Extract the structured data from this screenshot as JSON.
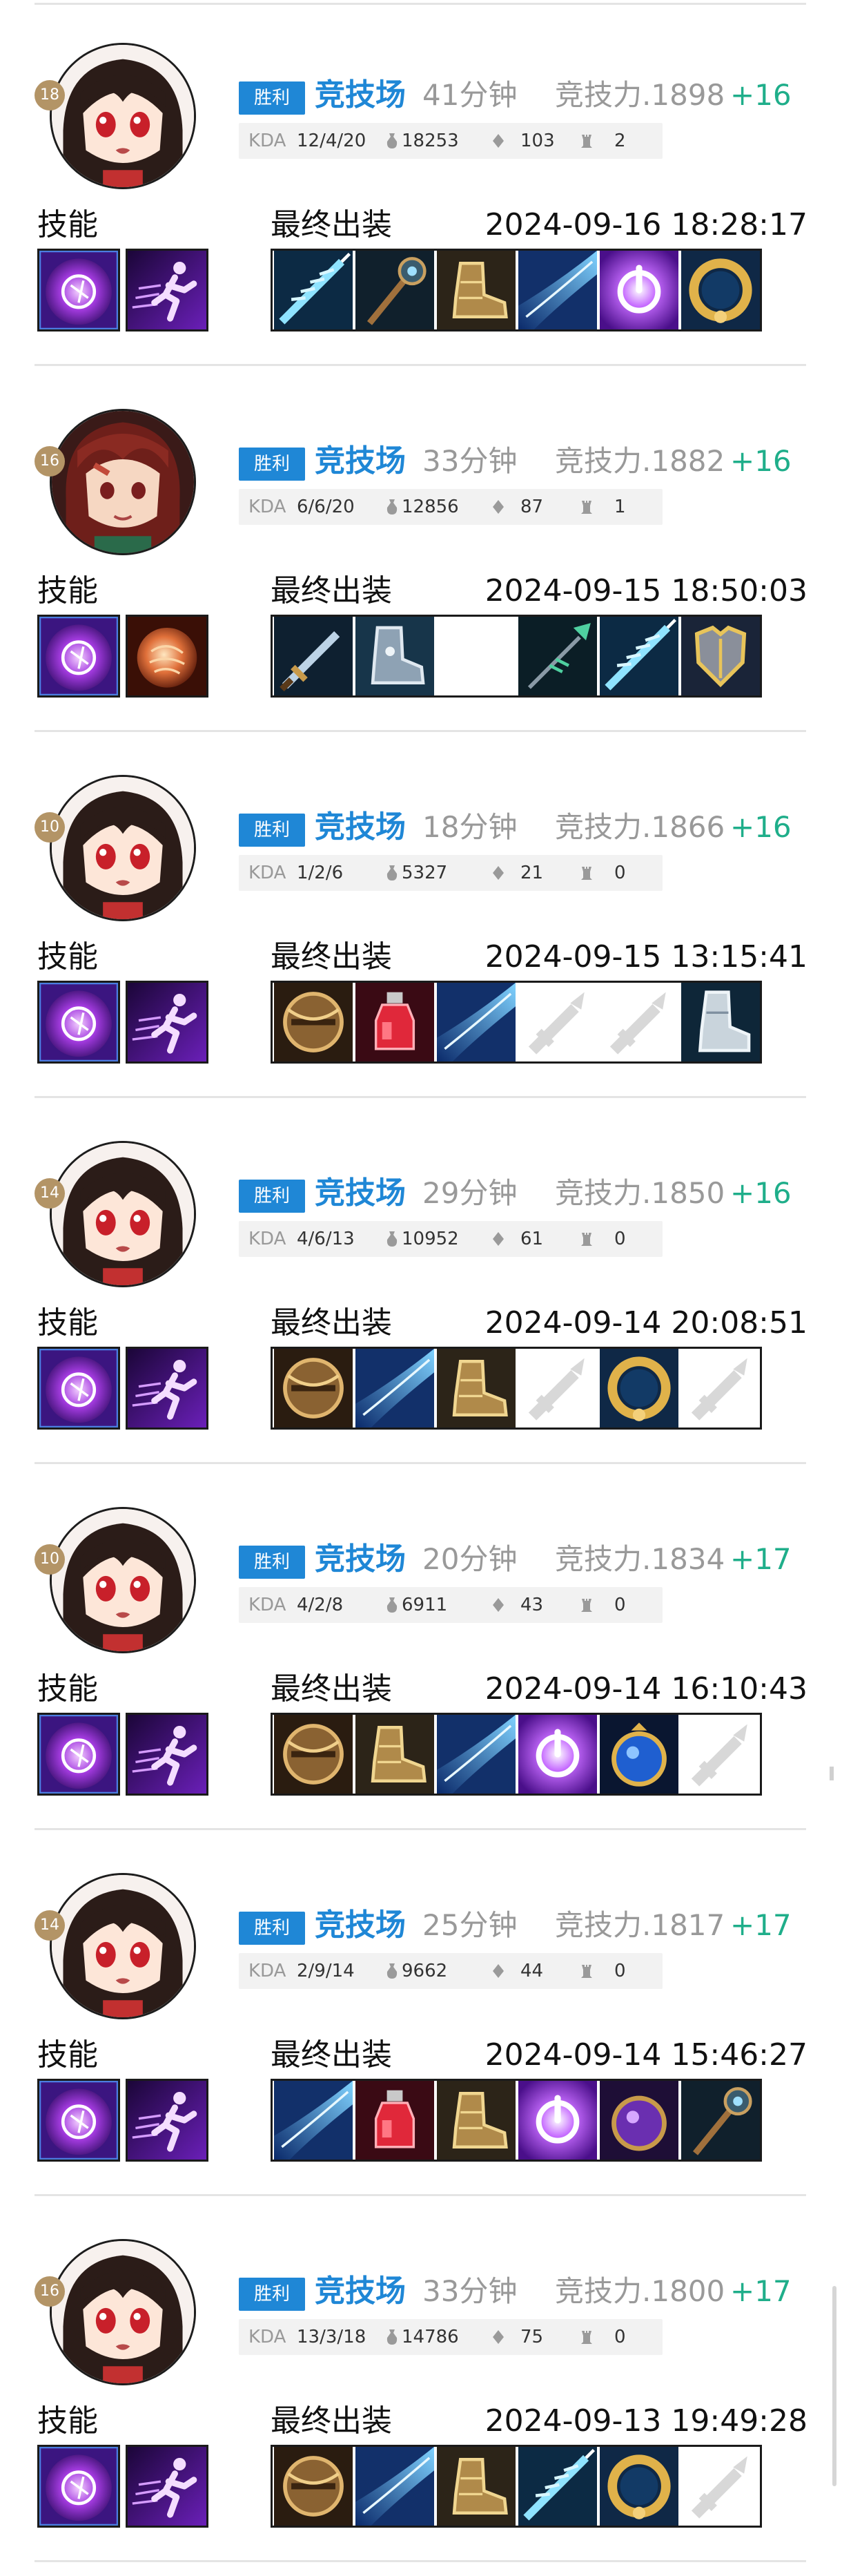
{
  "colors": {
    "accent_blue": "#1f87d6",
    "win_badge": "#1f87d6",
    "rating_gain": "#1fae8a",
    "muted_text": "#999999",
    "level_badge": "#b39466",
    "stat_bar_bg": "#f2f2f2"
  },
  "labels": {
    "skills": "技能",
    "final_build": "最终出装",
    "kda": "KDA",
    "rating_prefix": "竞技力."
  },
  "matches": [
    {
      "hero_level": "18",
      "result": "胜利",
      "mode": "竞技场",
      "duration": "41分钟",
      "rating": "1898",
      "rating_delta": "+16",
      "kda": "12/4/20",
      "gold": "18253",
      "last_hits": "103",
      "towers": "2",
      "date": "2024-09-16 18:28:17",
      "avatar": "girl-red-eyes",
      "skills": [
        "purple-orb-skill-icon",
        "sprint-skill-icon"
      ],
      "items": [
        "ice-dagger-item-icon",
        "dark-staff-item-icon",
        "gold-boots-item-icon",
        "blue-blade-item-icon",
        "purple-power-item-icon",
        "gold-ring-item-icon"
      ]
    },
    {
      "hero_level": "16",
      "result": "胜利",
      "mode": "竞技场",
      "duration": "33分钟",
      "rating": "1882",
      "rating_delta": "+16",
      "kda": "6/6/20",
      "gold": "12856",
      "last_hits": "87",
      "towers": "1",
      "date": "2024-09-15 18:50:03",
      "avatar": "boy-red-hair",
      "skills": [
        "purple-orb-skill-icon",
        "fire-orb-skill-icon"
      ],
      "items": [
        "long-sword-item-icon",
        "steel-boots-item-icon",
        "empty-item-slot",
        "green-spear-item-icon",
        "ice-dagger-item-icon",
        "gold-armor-item-icon"
      ]
    },
    {
      "hero_level": "10",
      "result": "胜利",
      "mode": "竞技场",
      "duration": "18分钟",
      "rating": "1866",
      "rating_delta": "+16",
      "kda": "1/2/6",
      "gold": "5327",
      "last_hits": "21",
      "towers": "0",
      "date": "2024-09-15 13:15:41",
      "avatar": "girl-red-eyes",
      "skills": [
        "purple-orb-skill-icon",
        "sprint-skill-icon"
      ],
      "items": [
        "bronze-shield-item-icon",
        "red-potion-item-icon",
        "blue-blade-item-icon",
        "empty-sword-slot-icon",
        "empty-sword-slot-icon",
        "silver-boots-item-icon"
      ]
    },
    {
      "hero_level": "14",
      "result": "胜利",
      "mode": "竞技场",
      "duration": "29分钟",
      "rating": "1850",
      "rating_delta": "+16",
      "kda": "4/6/13",
      "gold": "10952",
      "last_hits": "61",
      "towers": "0",
      "date": "2024-09-14 20:08:51",
      "avatar": "girl-red-eyes",
      "skills": [
        "purple-orb-skill-icon",
        "sprint-skill-icon"
      ],
      "items": [
        "bronze-shield-item-icon",
        "blue-blade-item-icon",
        "gold-boots-item-icon",
        "empty-sword-slot-icon",
        "gold-ring-item-icon",
        "empty-sword-slot-icon"
      ]
    },
    {
      "hero_level": "10",
      "result": "胜利",
      "mode": "竞技场",
      "duration": "20分钟",
      "rating": "1834",
      "rating_delta": "+17",
      "kda": "4/2/8",
      "gold": "6911",
      "last_hits": "43",
      "towers": "0",
      "date": "2024-09-14 16:10:43",
      "avatar": "girl-red-eyes",
      "skills": [
        "purple-orb-skill-icon",
        "sprint-skill-icon"
      ],
      "items": [
        "bronze-shield-item-icon",
        "gold-boots-item-icon",
        "blue-blade-item-icon",
        "purple-power-item-icon",
        "blue-orb-item-icon",
        "empty-sword-slot-icon"
      ]
    },
    {
      "hero_level": "14",
      "result": "胜利",
      "mode": "竞技场",
      "duration": "25分钟",
      "rating": "1817",
      "rating_delta": "+17",
      "kda": "2/9/14",
      "gold": "9662",
      "last_hits": "44",
      "towers": "0",
      "date": "2024-09-14 15:46:27",
      "avatar": "girl-red-eyes",
      "skills": [
        "purple-orb-skill-icon",
        "sprint-skill-icon"
      ],
      "items": [
        "blue-blade-item-icon",
        "red-potion-item-icon",
        "gold-boots-item-icon",
        "purple-power-item-icon",
        "purple-orb-item-icon",
        "dark-staff-item-icon"
      ]
    },
    {
      "hero_level": "16",
      "result": "胜利",
      "mode": "竞技场",
      "duration": "33分钟",
      "rating": "1800",
      "rating_delta": "+17",
      "kda": "13/3/18",
      "gold": "14786",
      "last_hits": "75",
      "towers": "0",
      "date": "2024-09-13 19:49:28",
      "avatar": "girl-red-eyes",
      "skills": [
        "purple-orb-skill-icon",
        "sprint-skill-icon"
      ],
      "items": [
        "bronze-shield-item-icon",
        "blue-blade-item-icon",
        "gold-boots-item-icon",
        "ice-dagger-item-icon",
        "gold-ring-item-icon",
        "empty-sword-slot-icon"
      ]
    }
  ]
}
